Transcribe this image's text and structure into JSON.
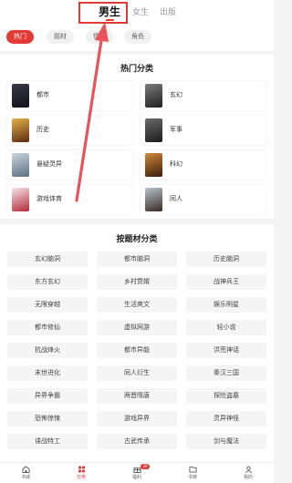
{
  "gender_tabs": [
    "男生",
    "女生",
    "出版"
  ],
  "chips": [
    "热门",
    "题材",
    "情节",
    "角色"
  ],
  "hot_section": {
    "title": "热门分类",
    "items": [
      "都市",
      "玄幻",
      "历史",
      "军事",
      "悬疑灵异",
      "科幻",
      "游戏体育",
      "同人"
    ]
  },
  "theme_section": {
    "title": "按题材分类",
    "tags": [
      "玄幻脑洞",
      "都市脑洞",
      "历史脑洞",
      "东方玄幻",
      "乡村赘婿",
      "战神兵王",
      "无限穿越",
      "生活爽文",
      "娱乐明星",
      "都市修仙",
      "虚拟网游",
      "轻小说",
      "抗战烽火",
      "都市异能",
      "洪荒神话",
      "末世进化",
      "同人衍生",
      "秦汉三国",
      "异界争霸",
      "两晋隋唐",
      "探险盗墓",
      "恐怖惊悚",
      "游戏异界",
      "灵异神怪",
      "谍战特工",
      "古武传承",
      "剑与魔法"
    ]
  },
  "bottom_nav": [
    {
      "label": "书城",
      "icon": "home-icon"
    },
    {
      "label": "分类",
      "icon": "category-icon"
    },
    {
      "label": "福利",
      "icon": "gift-icon",
      "badge": "39"
    },
    {
      "label": "书架",
      "icon": "bookshelf-icon"
    },
    {
      "label": "我的",
      "icon": "profile-icon"
    }
  ],
  "colors": {
    "accent": "#e53935",
    "arrow": "#e8545a"
  }
}
